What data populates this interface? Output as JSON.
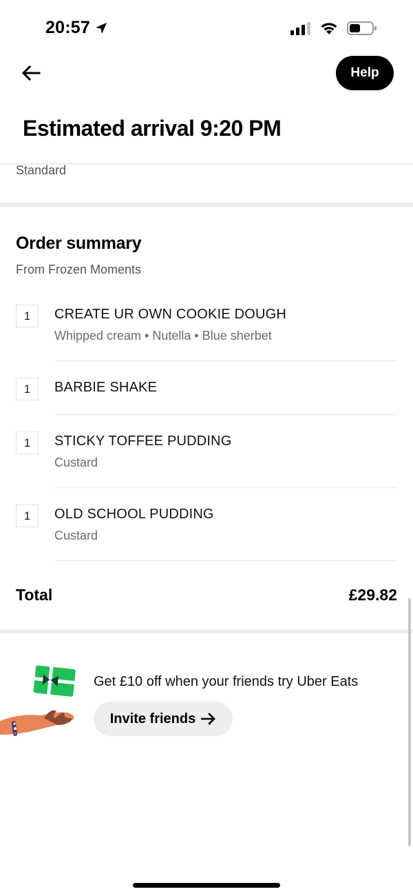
{
  "status_bar": {
    "time": "20:57",
    "icons": [
      "location-arrow-icon",
      "cellular-signal-icon",
      "wifi-icon",
      "battery-icon"
    ]
  },
  "header": {
    "back_icon": "arrow-left-icon",
    "help_label": "Help",
    "title": "Estimated arrival 9:20 PM"
  },
  "delivery": {
    "type": "Standard"
  },
  "order_summary": {
    "title": "Order summary",
    "subtitle": "From Frozen Moments",
    "items": [
      {
        "qty": "1",
        "name": "CREATE UR OWN COOKIE DOUGH",
        "options": "Whipped cream • Nutella • Blue sherbet"
      },
      {
        "qty": "1",
        "name": "BARBIE SHAKE",
        "options": ""
      },
      {
        "qty": "1",
        "name": "STICKY TOFFEE PUDDING",
        "options": "Custard"
      },
      {
        "qty": "1",
        "name": "OLD SCHOOL PUDDING",
        "options": "Custard"
      }
    ],
    "total_label": "Total",
    "total_value": "£29.82"
  },
  "promo": {
    "illustration": "gift-card-hand-illustration",
    "text": "Get £10 off when your friends try Uber Eats",
    "button_label": "Invite friends",
    "button_icon": "arrow-right-icon"
  },
  "colors": {
    "accent": "#000000",
    "secondary_text": "#545454",
    "muted_text": "#6b6b6b",
    "pill_bg": "#eeeeee",
    "gift_green": "#1fbf5a"
  }
}
